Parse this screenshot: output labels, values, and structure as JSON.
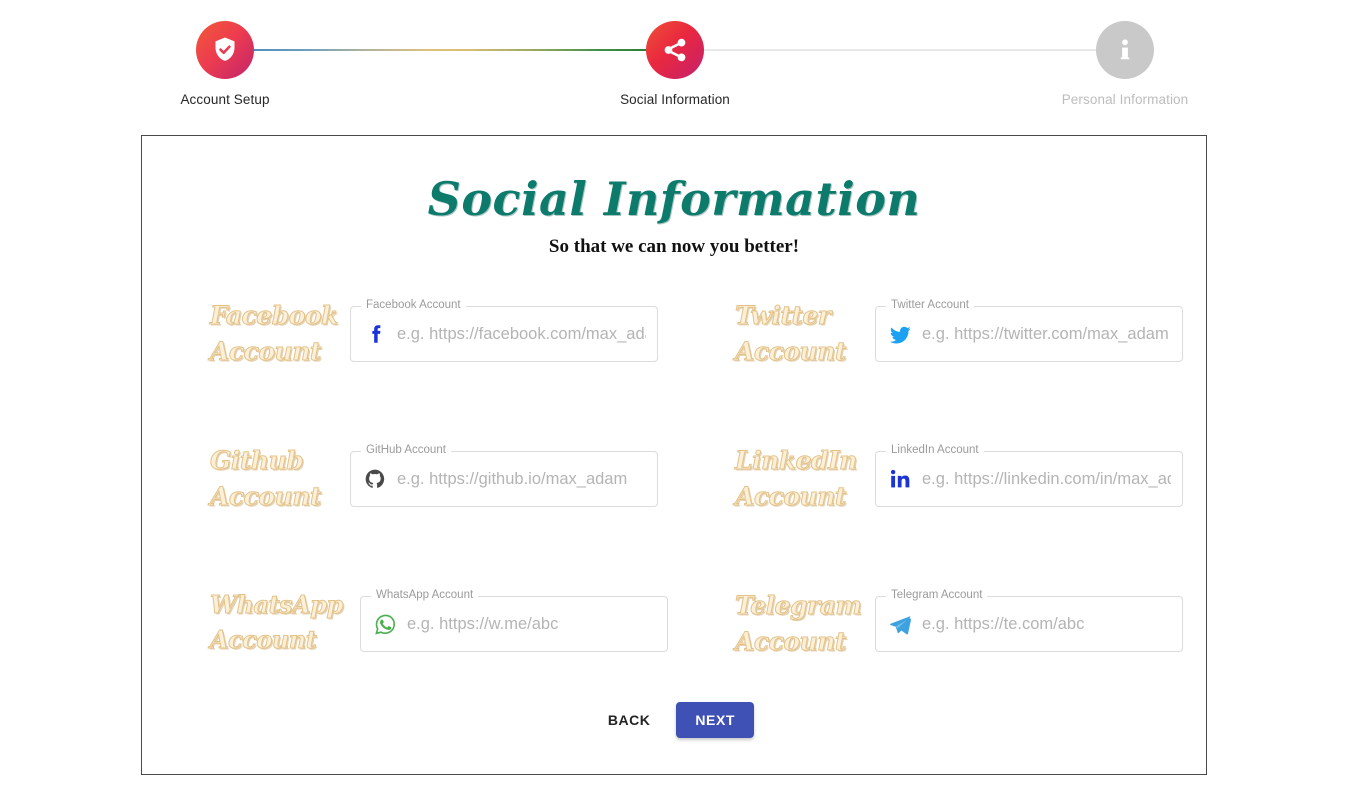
{
  "stepper": {
    "steps": [
      {
        "label": "Account Setup",
        "icon": "shield-check-icon",
        "state": "complete"
      },
      {
        "label": "Social Information",
        "icon": "share-icon",
        "state": "active"
      },
      {
        "label": "Personal Information",
        "icon": "info-icon",
        "state": "inactive"
      }
    ]
  },
  "card": {
    "title": "Social Information",
    "subtitle": "So that we can now you better!",
    "fields": [
      {
        "script_label": "Facebook\nAccount",
        "legend": "Facebook Account",
        "placeholder": "e.g. https://facebook.com/max_adam",
        "value": "",
        "icon": "facebook-icon",
        "icon_color": "#1a34d8"
      },
      {
        "script_label": "Twitter\nAccount",
        "legend": "Twitter Account",
        "placeholder": "e.g. https://twitter.com/max_adam",
        "value": "",
        "icon": "twitter-icon",
        "icon_color": "#1da1f2"
      },
      {
        "script_label": "Github\nAccount",
        "legend": "GitHub Account",
        "placeholder": "e.g. https://github.io/max_adam",
        "value": "",
        "icon": "github-icon",
        "icon_color": "#4a4a4a"
      },
      {
        "script_label": "LinkedIn\nAccount",
        "legend": "LinkedIn Account",
        "placeholder": "e.g. https://linkedin.com/in/max_adam",
        "value": "",
        "icon": "linkedin-icon",
        "icon_color": "#1a34d8"
      },
      {
        "script_label": "WhatsApp\nAccount",
        "legend": "WhatsApp Account",
        "placeholder": "e.g. https://w.me/abc",
        "value": "",
        "icon": "whatsapp-icon",
        "icon_color": "#4caf50"
      },
      {
        "script_label": "Telegram\nAccount",
        "legend": "Telegram Account",
        "placeholder": "e.g. https://te.com/abc",
        "value": "",
        "icon": "telegram-icon",
        "icon_color": "#3fa2e0"
      }
    ],
    "actions": {
      "back_label": "BACK",
      "next_label": "NEXT"
    }
  },
  "colors": {
    "title": "#0c7b6c",
    "next_button": "#3f51b5",
    "script_label_fill": "#fdf0d8",
    "script_label_outline": "#e3c288",
    "step_active_gradient_start": "#f05a38",
    "step_active_gradient_end": "#c2246c",
    "step_inactive": "#c9c9c9"
  }
}
